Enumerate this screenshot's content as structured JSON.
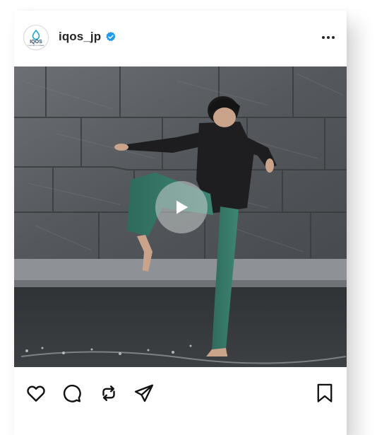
{
  "post": {
    "username": "iqos_jp",
    "verified": true,
    "avatar_logo_text": "IQOS",
    "avatar_logo_subtext": "TOGETHER X FORWARD",
    "more_icon": "more-horizontal-icon",
    "media_type": "video",
    "play_icon": "play-icon"
  },
  "actions": {
    "icons": [
      "heart-icon",
      "comment-icon",
      "repost-icon",
      "share-icon",
      "bookmark-icon"
    ]
  },
  "colors": {
    "verified_badge": "#1d9bf0",
    "text": "#262626",
    "icon": "#111111"
  }
}
